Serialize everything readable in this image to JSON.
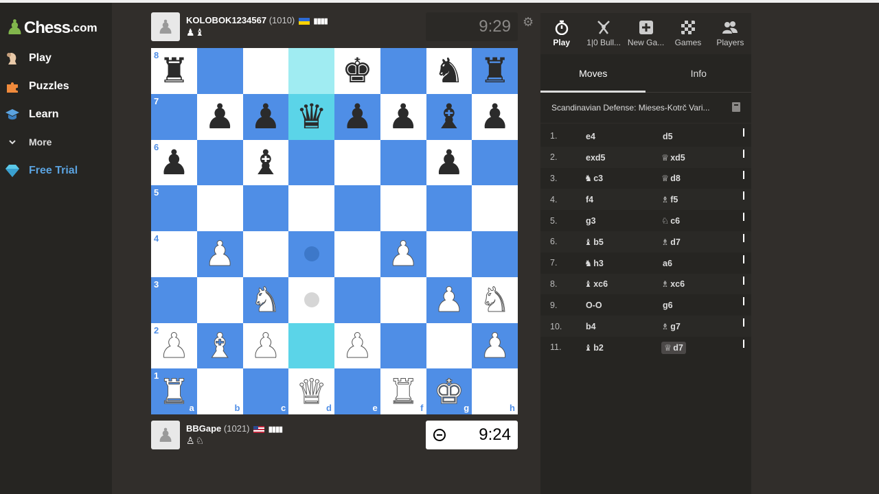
{
  "sidebar": {
    "logo_text": "Chess",
    "logo_suffix": ".com",
    "items": [
      {
        "label": "Play",
        "icon": "play-pawn-icon"
      },
      {
        "label": "Puzzles",
        "icon": "puzzle-piece-icon"
      },
      {
        "label": "Learn",
        "icon": "graduation-cap-icon"
      },
      {
        "label": "More",
        "icon": "chevron-down-icon"
      },
      {
        "label": "Free Trial",
        "icon": "diamond-icon"
      }
    ]
  },
  "top_player": {
    "name": "KOLOBOK1234567",
    "rating": "(1010)",
    "flag": "UA",
    "captured": "♟♝",
    "clock": "9:29"
  },
  "bottom_player": {
    "name": "BBGape",
    "rating": "(1021)",
    "flag": "US",
    "captured": "♙♘",
    "clock": "9:24"
  },
  "board": {
    "files": [
      "a",
      "b",
      "c",
      "d",
      "e",
      "f",
      "g",
      "h"
    ],
    "ranks": [
      "8",
      "7",
      "6",
      "5",
      "4",
      "3",
      "2",
      "1"
    ],
    "rows": [
      [
        "r",
        "",
        "",
        "",
        "k",
        "",
        "n",
        "r"
      ],
      [
        "",
        "p",
        "p",
        "q",
        "p",
        "p",
        "b",
        "p"
      ],
      [
        "p",
        "",
        "b",
        "",
        "",
        "",
        "p",
        ""
      ],
      [
        "",
        "",
        "",
        "",
        "",
        "",
        "",
        ""
      ],
      [
        "",
        "P",
        "",
        "",
        "",
        "P",
        "",
        ""
      ],
      [
        "",
        "",
        "N",
        "",
        "",
        "",
        "P",
        "N"
      ],
      [
        "P",
        "B",
        "P",
        "",
        "P",
        "",
        "",
        "P"
      ],
      [
        "R",
        "",
        "",
        "Q",
        "",
        "R",
        "K",
        ""
      ]
    ],
    "last_move": [
      "d8",
      "d7"
    ],
    "selected": "d2",
    "move_hints": [
      "d4",
      "d3"
    ]
  },
  "panel": {
    "tabs": [
      {
        "label": "Play",
        "icon": "stopwatch-icon"
      },
      {
        "label": "1|0 Bull...",
        "icon": "bullet-icon"
      },
      {
        "label": "New Ga...",
        "icon": "plus-icon"
      },
      {
        "label": "Games",
        "icon": "board-icon"
      },
      {
        "label": "Players",
        "icon": "players-icon"
      }
    ],
    "subtabs": [
      "Moves",
      "Info"
    ],
    "opening": "Scandinavian Defense: Mieses-Kotrč Vari...",
    "moves": [
      {
        "n": "1.",
        "w_fig": "",
        "w": "e4",
        "b_fig": "",
        "b": "d5"
      },
      {
        "n": "2.",
        "w_fig": "",
        "w": "exd5",
        "b_fig": "♕",
        "b": "xd5"
      },
      {
        "n": "3.",
        "w_fig": "♞",
        "w": "c3",
        "b_fig": "♕",
        "b": "d8"
      },
      {
        "n": "4.",
        "w_fig": "",
        "w": "f4",
        "b_fig": "♗",
        "b": "f5"
      },
      {
        "n": "5.",
        "w_fig": "",
        "w": "g3",
        "b_fig": "♘",
        "b": "c6"
      },
      {
        "n": "6.",
        "w_fig": "♝",
        "w": "b5",
        "b_fig": "♗",
        "b": "d7"
      },
      {
        "n": "7.",
        "w_fig": "♞",
        "w": "h3",
        "b_fig": "",
        "b": "a6"
      },
      {
        "n": "8.",
        "w_fig": "♝",
        "w": "xc6",
        "b_fig": "♗",
        "b": "xc6"
      },
      {
        "n": "9.",
        "w_fig": "",
        "w": "O-O",
        "b_fig": "",
        "b": "g6"
      },
      {
        "n": "10.",
        "w_fig": "",
        "w": "b4",
        "b_fig": "♗",
        "b": "g7"
      },
      {
        "n": "11.",
        "w_fig": "♝",
        "w": "b2",
        "b_fig": "♕",
        "b": "d7"
      }
    ]
  },
  "colors": {
    "board_light": "#ffffff",
    "board_dark": "#4f8ee6",
    "highlight": "#5bd4e8",
    "free_trial": "#5ba3e0"
  }
}
